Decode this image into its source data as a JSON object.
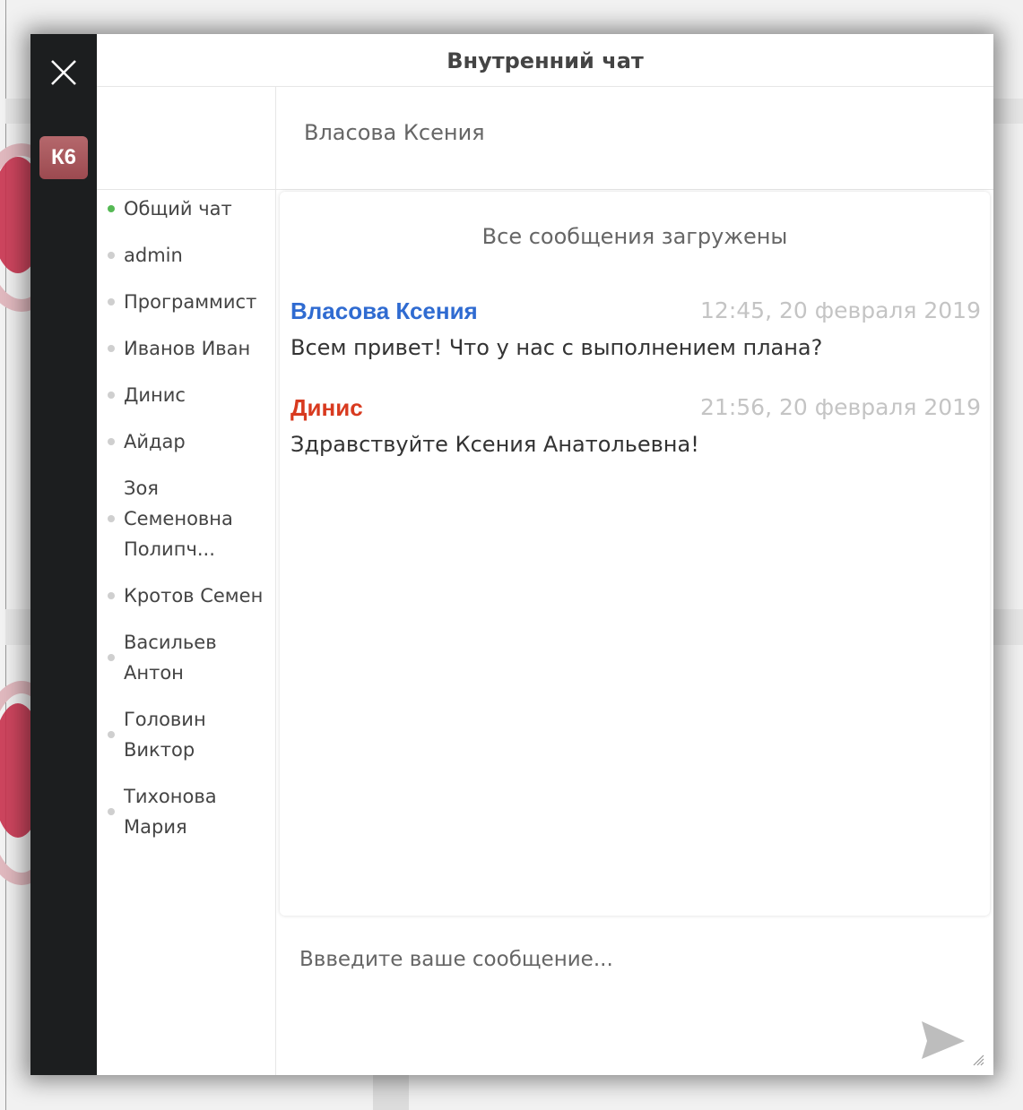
{
  "chat": {
    "title": "Внутренний чат",
    "user_badge": "К6",
    "active_contact": "Власова Ксения",
    "status_message": "Все сообщения загружены",
    "input_placeholder": "Ввведите ваше сообщение..."
  },
  "users": [
    {
      "label": "Общий чат",
      "online": true
    },
    {
      "label": "admin",
      "online": false
    },
    {
      "label": "Программист",
      "online": false
    },
    {
      "label": "Иванов Иван",
      "online": false
    },
    {
      "label": "Динис",
      "online": false
    },
    {
      "label": "Айдар",
      "online": false
    },
    {
      "label": "Зоя Семеновна Полипч...",
      "online": false
    },
    {
      "label": "Кротов Семен",
      "online": false
    },
    {
      "label": "Васильев Антон",
      "online": false
    },
    {
      "label": "Головин Виктор",
      "online": false
    },
    {
      "label": "Тихонова Мария",
      "online": false
    }
  ],
  "messages": [
    {
      "author": "Власова Ксения",
      "time": "12:45, 20 февраля 2019",
      "text": "Всем привет! Что у нас с выполнением плана?",
      "author_color": "#2f6bd1"
    },
    {
      "author": "Динис",
      "time": "21:56, 20 февраля 2019",
      "text": "Здравствуйте Ксения Анатольевна!",
      "author_color": "#d83a1f"
    }
  ],
  "icons": {
    "close": "close-icon",
    "send": "send-icon",
    "online_dot": "#55b954",
    "offline_dot": "#cfcfcf"
  }
}
